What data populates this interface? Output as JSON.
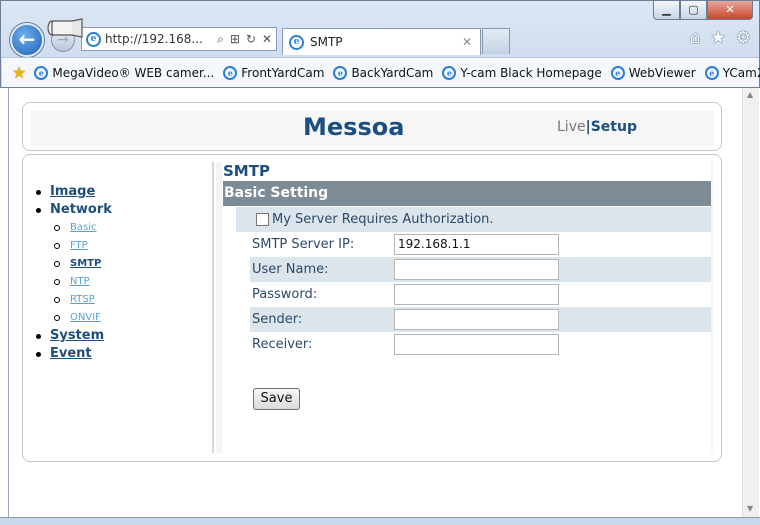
{
  "browser": {
    "address": "http://192.168...",
    "tab_title": "SMTP",
    "favorites": [
      "MegaVideo® WEB camer...",
      "FrontYardCam",
      "BackYardCam",
      "Y-cam Black Homepage",
      "WebViewer",
      "YCam2"
    ]
  },
  "header": {
    "brand": "Messoa",
    "live": "Live",
    "separator": "|",
    "setup": "Setup"
  },
  "sidebar": {
    "image": "Image",
    "network": "Network",
    "network_items": [
      "Basic",
      "FTP",
      "SMTP",
      "NTP",
      "RTSP",
      "ONVIF"
    ],
    "system": "System",
    "event": "Event"
  },
  "page": {
    "title": "SMTP",
    "section": "Basic Setting",
    "auth_label": "My Server Requires Authorization.",
    "fields": {
      "server_ip_label": "SMTP Server IP:",
      "server_ip_value": "192.168.1.1",
      "username_label": "User Name:",
      "password_label": "Password:",
      "sender_label": "Sender:",
      "receiver_label": "Receiver:"
    },
    "save": "Save"
  }
}
